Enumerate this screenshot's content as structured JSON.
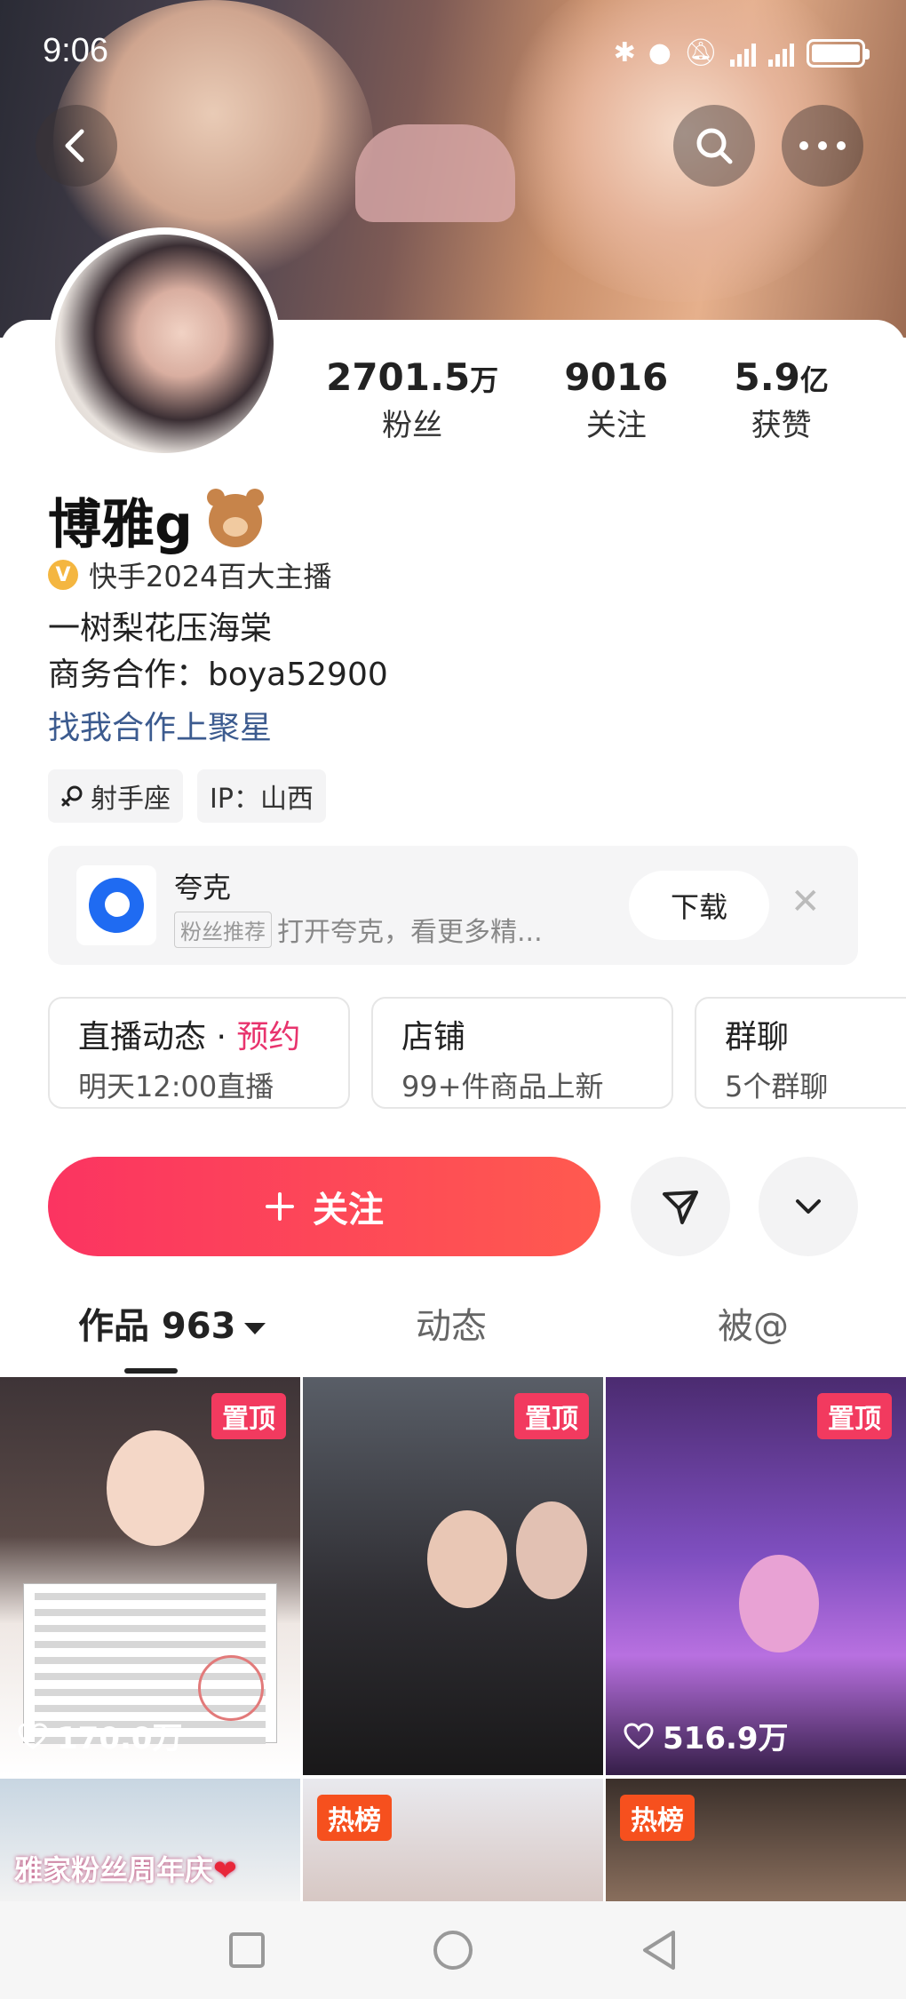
{
  "status_bar": {
    "time": "9:06"
  },
  "header": {
    "back_icon": "chevron-left-icon",
    "search_icon": "search-icon",
    "more_icon": "more-horizontal-icon"
  },
  "profile": {
    "name": "博雅g",
    "name_emoji": "teddy-bear",
    "verification": "快手2024百大主播",
    "bio_line1": "一树梨花压海棠",
    "bio_line2": "商务合作：boya52900",
    "cooperation_link": "找我合作上聚星",
    "tags": [
      {
        "label": "射手座",
        "icon": "male-symbol-icon"
      },
      {
        "label": "IP：山西"
      }
    ]
  },
  "stats": [
    {
      "value": "2701.5",
      "unit": "万",
      "label": "粉丝"
    },
    {
      "value": "9016",
      "unit": "",
      "label": "关注"
    },
    {
      "value": "5.9",
      "unit": "亿",
      "label": "获赞"
    }
  ],
  "promo": {
    "app_name": "夸克",
    "badge": "粉丝推荐",
    "description": "打开夸克，看更多精...",
    "download_label": "下载"
  },
  "feature_cards": [
    {
      "title": "直播动态",
      "title_extra": "预约",
      "subtitle": "明天12:00直播"
    },
    {
      "title": "店铺",
      "subtitle": "99+件商品上新"
    },
    {
      "title": "群聊",
      "subtitle": "5个群聊"
    }
  ],
  "actions": {
    "follow_label": "关注",
    "share_icon": "send-icon",
    "expand_icon": "chevron-down-icon"
  },
  "tabs": [
    {
      "label": "作品 963",
      "active": true
    },
    {
      "label": "动态",
      "active": false
    },
    {
      "label": "被@",
      "active": false
    }
  ],
  "grid": [
    {
      "badge": "置顶",
      "likes": "170.0万"
    },
    {
      "badge": "置顶"
    },
    {
      "badge": "置顶",
      "likes": "516.9万"
    },
    {
      "caption": "雅家粉丝周年庆"
    },
    {
      "badge": "热榜"
    },
    {
      "badge": "热榜"
    }
  ],
  "colors": {
    "accent": "#fb3461",
    "link": "#3c5b8f",
    "pin_badge": "#f23a5f",
    "hot_badge": "#f6501e"
  }
}
